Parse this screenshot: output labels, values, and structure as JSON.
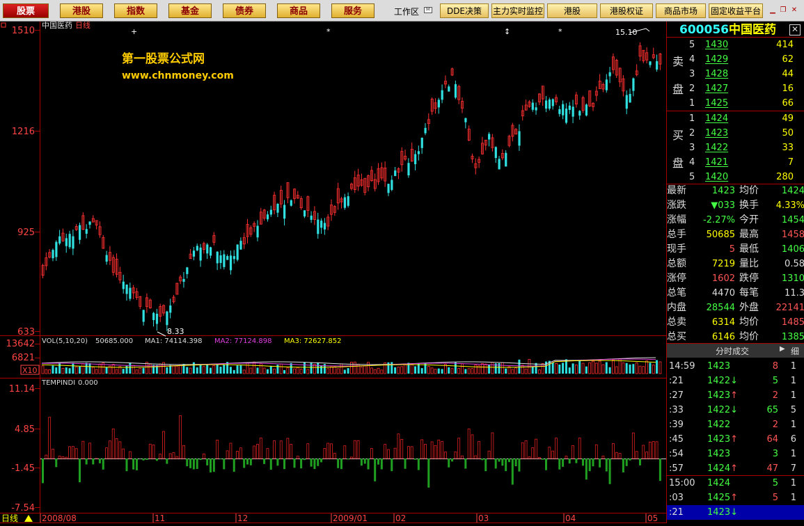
{
  "toolbar": {
    "tabs": [
      "股票",
      "港股",
      "指数",
      "基金",
      "债券",
      "商品",
      "服务"
    ],
    "workspace": "工作区",
    "links": [
      "DDE决策",
      "主力实时监控",
      "港股",
      "港股权证",
      "商品市场",
      "固定收益平台"
    ]
  },
  "chart": {
    "stock_name": "中国医药",
    "period": "日线",
    "watermark_line1": "第一股票公式网",
    "watermark_line2": "www.chnmoney.com",
    "price_axis": [
      "1510",
      "1216",
      "925",
      "633"
    ],
    "high_label": "15.10",
    "low_label": "8.33",
    "vol_title": "VOL(5,10,20)",
    "vol_value": "50685.000",
    "ma1": "MA1: 74114.398",
    "ma2": "MA2: 77124.898",
    "ma3": "MA3: 72627.852",
    "vol_axis": [
      "13642",
      "6821",
      "X10"
    ],
    "ind_title": "TEMPINDI",
    "ind_value": "0.000",
    "ind_axis": [
      "11.14",
      "4.85",
      "-1.45",
      "-7.54"
    ],
    "date_labels": [
      "2008/08",
      "11",
      "12",
      "2009/01",
      "02",
      "03",
      "04",
      "05"
    ],
    "period_label": "日线",
    "colors": {
      "up": "#ff3030",
      "down": "#30e0e0",
      "ind_up": "#e02020",
      "ind_down": "#20a020"
    }
  },
  "quote": {
    "code": "600056",
    "name": "中国医药",
    "sell_label_1": "卖",
    "sell_label_2": "盘",
    "buy_label_1": "买",
    "buy_label_2": "盘",
    "asks": [
      {
        "lv": "5",
        "price": "1430",
        "vol": "414"
      },
      {
        "lv": "4",
        "price": "1429",
        "vol": "62"
      },
      {
        "lv": "3",
        "price": "1428",
        "vol": "44"
      },
      {
        "lv": "2",
        "price": "1427",
        "vol": "16"
      },
      {
        "lv": "1",
        "price": "1425",
        "vol": "66"
      }
    ],
    "bids": [
      {
        "lv": "1",
        "price": "1424",
        "vol": "49"
      },
      {
        "lv": "2",
        "price": "1423",
        "vol": "50"
      },
      {
        "lv": "3",
        "price": "1422",
        "vol": "33"
      },
      {
        "lv": "4",
        "price": "1421",
        "vol": "7"
      },
      {
        "lv": "5",
        "price": "1420",
        "vol": "280"
      }
    ],
    "stats": [
      {
        "l1": "最新",
        "v1": "1423",
        "c1": "g",
        "l2": "均价",
        "v2": "1424",
        "c2": "g"
      },
      {
        "l1": "涨跌",
        "v1": "▼033",
        "c1": "g",
        "l2": "换手",
        "v2": "4.33%",
        "c2": "y"
      },
      {
        "l1": "涨幅",
        "v1": "-2.27%",
        "c1": "g",
        "l2": "今开",
        "v2": "1454",
        "c2": "g"
      },
      {
        "l1": "总手",
        "v1": "50685",
        "c1": "y",
        "l2": "最高",
        "v2": "1458",
        "c2": "r"
      },
      {
        "l1": "现手",
        "v1": "5",
        "c1": "r",
        "l2": "最低",
        "v2": "1406",
        "c2": "g"
      },
      {
        "l1": "总额",
        "v1": "7219",
        "c1": "y",
        "l2": "量比",
        "v2": "0.58",
        "c2": "w"
      },
      {
        "l1": "涨停",
        "v1": "1602",
        "c1": "r",
        "l2": "跌停",
        "v2": "1310",
        "c2": "g"
      },
      {
        "l1": "总笔",
        "v1": "4470",
        "c1": "w",
        "l2": "每笔",
        "v2": "11.3",
        "c2": "w"
      },
      {
        "l1": "内盘",
        "v1": "28544",
        "c1": "g",
        "l2": "外盘",
        "v2": "22141",
        "c2": "r"
      },
      {
        "l1": "总卖",
        "v1": "6314",
        "c1": "y",
        "l2": "均价",
        "v2": "1485",
        "c2": "r"
      },
      {
        "l1": "总买",
        "v1": "6146",
        "c1": "y",
        "l2": "均价",
        "v2": "1385",
        "c2": "g"
      }
    ],
    "ticks_title": "分时成交",
    "ticks_toggle": "细",
    "ticks": [
      {
        "t": "14:59",
        "p": "1423",
        "a": "",
        "v": "8",
        "n": "1",
        "pc": "g",
        "vc": "r"
      },
      {
        "t": ":21",
        "p": "1422",
        "a": "↓",
        "v": "5",
        "n": "1",
        "pc": "g",
        "vc": "g"
      },
      {
        "t": ":27",
        "p": "1423",
        "a": "↑",
        "v": "2",
        "n": "1",
        "pc": "g",
        "vc": "r"
      },
      {
        "t": ":33",
        "p": "1422",
        "a": "↓",
        "v": "65",
        "n": "5",
        "pc": "g",
        "vc": "g"
      },
      {
        "t": ":39",
        "p": "1422",
        "a": "",
        "v": "2",
        "n": "1",
        "pc": "g",
        "vc": "r"
      },
      {
        "t": ":45",
        "p": "1423",
        "a": "↑",
        "v": "64",
        "n": "6",
        "pc": "g",
        "vc": "r"
      },
      {
        "t": ":54",
        "p": "1423",
        "a": "",
        "v": "3",
        "n": "1",
        "pc": "g",
        "vc": "g"
      },
      {
        "t": ":57",
        "p": "1424",
        "a": "↑",
        "v": "47",
        "n": "7",
        "pc": "g",
        "vc": "r"
      },
      {
        "t": "15:00",
        "p": "1424",
        "a": "",
        "v": "5",
        "n": "1",
        "pc": "g",
        "vc": "g"
      },
      {
        "t": ":03",
        "p": "1425",
        "a": "↑",
        "v": "5",
        "n": "1",
        "pc": "g",
        "vc": "r"
      },
      {
        "t": ":21",
        "p": "1423",
        "a": "↓",
        "v": "",
        "n": "",
        "pc": "g",
        "vc": "g"
      }
    ]
  }
}
